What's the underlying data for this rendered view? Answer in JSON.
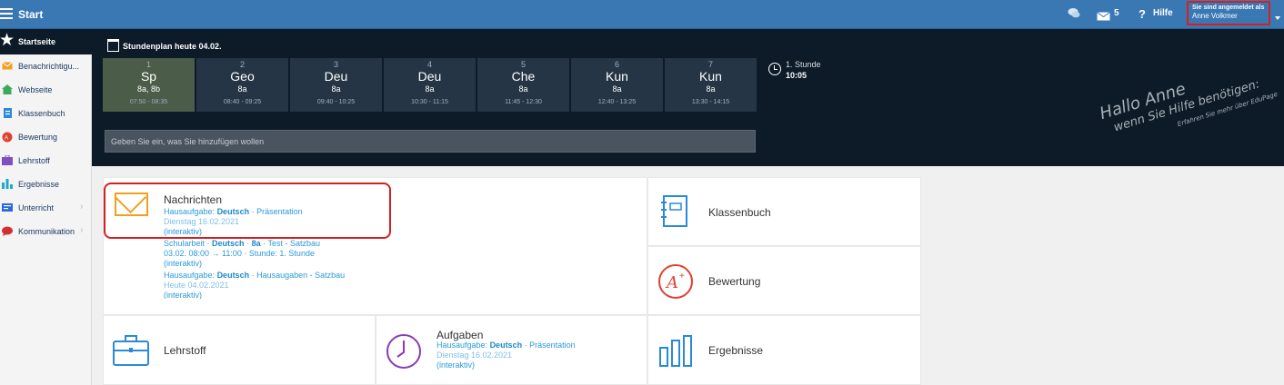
{
  "topbar": {
    "title": "Start",
    "messages_count": "5",
    "help_label": "Hilfe",
    "user_caption": "Sie sind angemeldet als",
    "user_name": "Anne Volkmer"
  },
  "sidebar": {
    "items": [
      {
        "label": "Startseite",
        "icon": "star-icon"
      },
      {
        "label": "Benachrichtigu...",
        "icon": "envelope-icon",
        "color": "#f0a020"
      },
      {
        "label": "Webseite",
        "icon": "house-icon",
        "color": "#3bab5a"
      },
      {
        "label": "Klassenbuch",
        "icon": "notebook-icon",
        "color": "#2a8ad8"
      },
      {
        "label": "Bewertung",
        "icon": "grade-icon",
        "color": "#e04030"
      },
      {
        "label": "Lehrstoff",
        "icon": "briefcase-icon",
        "color": "#8050c0"
      },
      {
        "label": "Ergebnisse",
        "icon": "bar-chart-icon",
        "color": "#20a8c8"
      },
      {
        "label": "Unterricht",
        "icon": "lesson-icon",
        "color": "#2a6ad8"
      },
      {
        "label": "Kommunikation",
        "icon": "chat-icon",
        "color": "#d03030"
      }
    ]
  },
  "schedule": {
    "title": "Stundenplan heute 04.02.",
    "lessons": [
      {
        "num": "1",
        "subject": "Sp",
        "class": "8a, 8b",
        "time": "07:50 - 08:35",
        "active": true
      },
      {
        "num": "2",
        "subject": "Geo",
        "class": "8a",
        "time": "08:40 - 09:25"
      },
      {
        "num": "3",
        "subject": "Deu",
        "class": "8a",
        "time": "09:40 - 10:25"
      },
      {
        "num": "4",
        "subject": "Deu",
        "class": "8a",
        "time": "10:30 - 11:15"
      },
      {
        "num": "5",
        "subject": "Che",
        "class": "8a",
        "time": "11:45 - 12:30"
      },
      {
        "num": "6",
        "subject": "Kun",
        "class": "8a",
        "time": "12:40 - 13:25"
      },
      {
        "num": "7",
        "subject": "Kun",
        "class": "8a",
        "time": "13:30 - 14:15"
      }
    ],
    "current_label": "1. Stunde",
    "current_time": "10:05",
    "input_placeholder": "Geben Sie ein, was Sie hinzufügen wollen",
    "hello_line1": "Hallo Anne",
    "hello_line2": "wenn Sie Hilfe benötigen:",
    "hello_line3": "Erfahren Sie mehr über EduPage"
  },
  "tiles": {
    "nachrichten": {
      "title": "Nachrichten",
      "l1_prefix": "Hausaufgabe:",
      "l1_subject": "Deutsch",
      "l1_rest": "· Präsentation",
      "l2": "Dienstag 16.02.2021",
      "l3": "(interaktiv)",
      "l4_prefix": "Schularbeit ·",
      "l4_subject": "Deutsch",
      "l4_sep": "·",
      "l4_class": "8a",
      "l4_rest": "· Test - Satzbau",
      "l5": "03.02. 08:00 → 11:00 · Stunde: 1. Stunde",
      "l6": "(interaktiv)",
      "l7_prefix": "Hausaufgabe:",
      "l7_subject": "Deutsch",
      "l7_rest": "· Hausaugaben - Satzbau",
      "l8": "Heute 04.02.2021",
      "l9": "(interaktiv)"
    },
    "klassenbuch": {
      "title": "Klassenbuch"
    },
    "bewertung": {
      "title": "Bewertung"
    },
    "lehrstoff": {
      "title": "Lehrstoff"
    },
    "aufgaben": {
      "title": "Aufgaben",
      "l1_prefix": "Hausaufgabe:",
      "l1_subject": "Deutsch",
      "l1_rest": "· Präsentation",
      "l2": "Dienstag 16.02.2021",
      "l3": "(interaktiv)"
    },
    "ergebnisse": {
      "title": "Ergebnisse"
    }
  },
  "colors": {
    "topbar": "#3a78b4",
    "panel": "#0d1b28",
    "link": "#2a9bd8",
    "highlight": "#d42020"
  }
}
